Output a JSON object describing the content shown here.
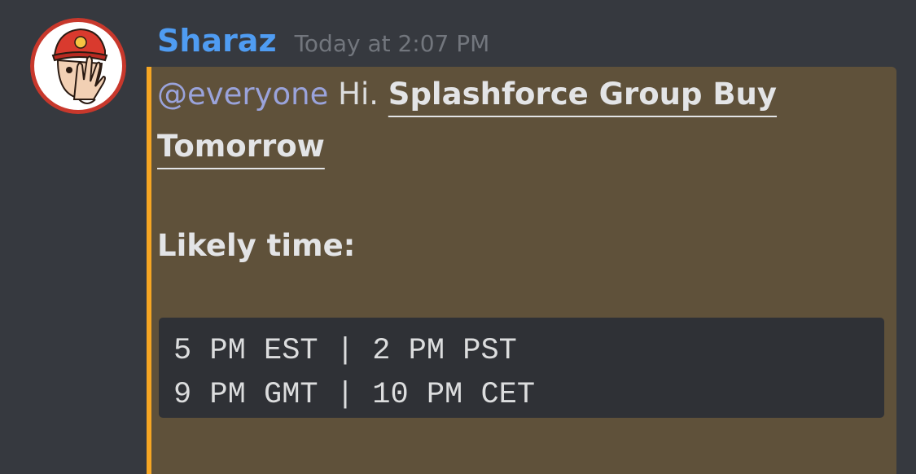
{
  "message": {
    "author": "Sharaz",
    "timestamp": "Today at 2:07 PM",
    "mention": "@everyone",
    "greeting": "Hi.",
    "headline_part1": "Splashforce Group Buy ",
    "headline_part2": "Tomorrow",
    "subheading": "Likely time:",
    "code_lines": [
      "5 PM EST | 2 PM PST",
      "9 PM GMT | 10 PM CET"
    ]
  },
  "colors": {
    "background": "#36393f",
    "username": "#4f9cf2",
    "timestamp": "#72767d",
    "mention_highlight_bg": "#5f513a",
    "mention_highlight_border": "#f6a623",
    "mention_text": "#9aa3db",
    "code_bg": "#2f3136"
  },
  "icons": {
    "avatar": "avatar-cartoon-face-red-cap"
  }
}
